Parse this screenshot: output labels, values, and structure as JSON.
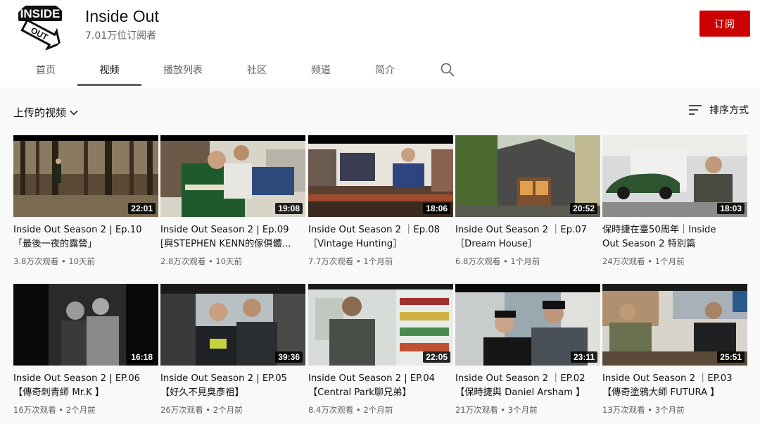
{
  "channel": {
    "name": "Inside Out",
    "subscribers": "7.01万位订阅者",
    "subscribe_label": "订阅",
    "logo_top": "INSIDE",
    "logo_bottom": "OUT"
  },
  "tabs": [
    {
      "label": "首页",
      "active": false
    },
    {
      "label": "视频",
      "active": true
    },
    {
      "label": "播放列表",
      "active": false
    },
    {
      "label": "社区",
      "active": false
    },
    {
      "label": "频道",
      "active": false
    },
    {
      "label": "简介",
      "active": false
    }
  ],
  "section": {
    "title": "上传的视频",
    "sort_label": "排序方式"
  },
  "videos": [
    {
      "line1": "Inside Out Season 2 | Ep.10",
      "line2": "「最後一夜的露營」",
      "views": "3.8万次观看",
      "age": "10天前",
      "duration": "22:01"
    },
    {
      "line1": "Inside Out Season 2 | Ep.09",
      "line2": "[與STEPHEN KENN的傢俱體...",
      "views": "2.8万次观看",
      "age": "10天前",
      "duration": "19:08"
    },
    {
      "line1": "Inside Out Season 2 ｜Ep.08",
      "line2": "［Vintage Hunting］",
      "views": "7.7万次观看",
      "age": "1个月前",
      "duration": "18:06"
    },
    {
      "line1": "Inside Out Season 2 ｜Ep.07",
      "line2": "［Dream House］",
      "views": "6.8万次观看",
      "age": "1个月前",
      "duration": "20:52"
    },
    {
      "line1": "保時捷在臺50周年｜Inside",
      "line2": "Out Season 2 特別篇",
      "views": "24万次观看",
      "age": "1个月前",
      "duration": "18:03"
    },
    {
      "line1": "Inside Out Season 2 | EP.06",
      "line2": "【傳奇刺青師 Mr.K 】",
      "views": "16万次观看",
      "age": "2个月前",
      "duration": "16:18"
    },
    {
      "line1": "Inside Out Season 2 | EP.05",
      "line2": "【好久不見臭彥祖】",
      "views": "26万次观看",
      "age": "2个月前",
      "duration": "39:36"
    },
    {
      "line1": "Inside Out Season 2 | EP.04",
      "line2": "【Central Park聊兄弟】",
      "views": "8.4万次观看",
      "age": "2个月前",
      "duration": "22:05"
    },
    {
      "line1": "Inside Out Season 2 ｜EP.02",
      "line2": "【保時捷與 Daniel Arsham 】",
      "views": "21万次观看",
      "age": "3个月前",
      "duration": "23:11"
    },
    {
      "line1": "Inside Out Season 2 ｜EP.03",
      "line2": "【傳奇塗鴉大師 FUTURA 】",
      "views": "13万次观看",
      "age": "3个月前",
      "duration": "25:51"
    }
  ],
  "colors": {
    "accent": "#cc0000",
    "background": "#f9f9f9",
    "header": "#ffffff",
    "secondary_text": "#606060"
  },
  "icons": [
    "search-icon",
    "chevron-down-icon",
    "sort-icon"
  ]
}
